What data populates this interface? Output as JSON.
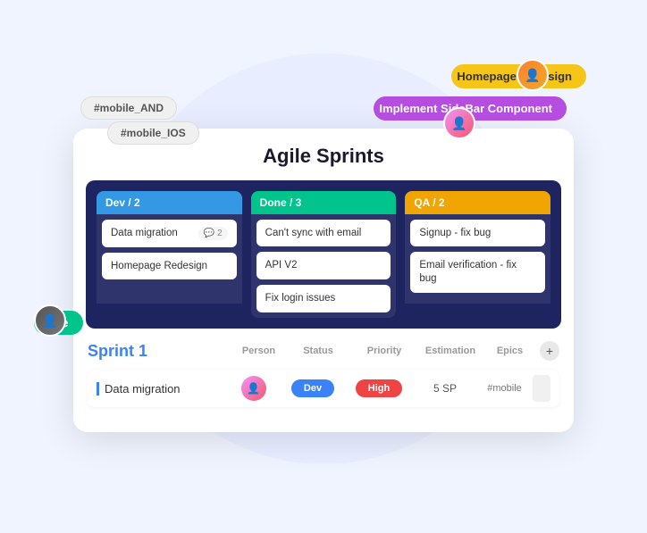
{
  "floating": {
    "tag_mobile_and": "#mobile_AND",
    "tag_mobile_ios": "#mobile_IOS",
    "badge_homepage": "Homepage Redesign",
    "badge_implement": "Implement SideBar Component",
    "badge_done": "Done"
  },
  "card": {
    "title": "Agile Sprints",
    "kanban": {
      "columns": [
        {
          "id": "dev",
          "header": "Dev / 2",
          "cards": [
            {
              "text": "Data migration",
              "comment_count": "2"
            },
            {
              "text": "Homepage Redesign",
              "comment_count": null
            }
          ]
        },
        {
          "id": "done",
          "header": "Done / 3",
          "cards": [
            {
              "text": "Can't sync with email",
              "comment_count": null
            },
            {
              "text": "API V2",
              "comment_count": null
            },
            {
              "text": "Fix login issues",
              "comment_count": null
            }
          ]
        },
        {
          "id": "qa",
          "header": "QA / 2",
          "cards": [
            {
              "text": "Signup - fix bug",
              "comment_count": null
            },
            {
              "text": "Email verification - fix bug",
              "comment_count": null
            }
          ]
        }
      ]
    }
  },
  "sprint": {
    "title": "Sprint 1",
    "columns": {
      "person": "Person",
      "status": "Status",
      "priority": "Priority",
      "estimation": "Estimation",
      "epics": "Epics"
    },
    "rows": [
      {
        "name": "Data migration",
        "status": "Dev",
        "priority": "High",
        "estimation": "5 SP",
        "epics": "#mobile"
      }
    ]
  }
}
